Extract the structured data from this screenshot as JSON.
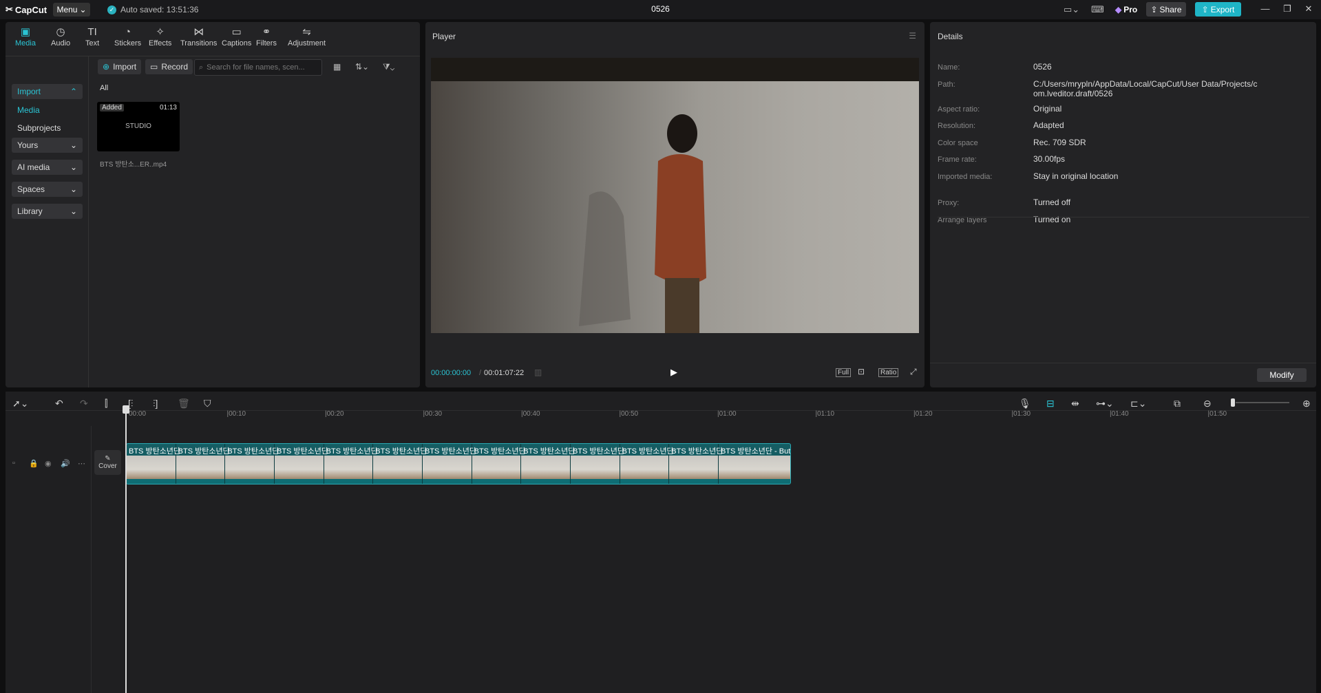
{
  "titlebar": {
    "logo": "CapCut",
    "menu": "Menu",
    "autosave": "Auto saved: 13:51:36",
    "project_title": "0526",
    "pro": "Pro",
    "share": "Share",
    "export": "Export"
  },
  "tabs": [
    {
      "label": "Media",
      "icon": "▣"
    },
    {
      "label": "Audio",
      "icon": "◷"
    },
    {
      "label": "Text",
      "icon": "TI"
    },
    {
      "label": "Stickers",
      "icon": "◔"
    },
    {
      "label": "Effects",
      "icon": "✧"
    },
    {
      "label": "Transitions",
      "icon": "⋈"
    },
    {
      "label": "Captions",
      "icon": "▭"
    },
    {
      "label": "Filters",
      "icon": "⚭"
    },
    {
      "label": "Adjustment",
      "icon": "⇋"
    }
  ],
  "sidebar": {
    "import": "Import",
    "media": "Media",
    "subprojects": "Subprojects",
    "yours": "Yours",
    "ai_media": "AI media",
    "spaces": "Spaces",
    "library": "Library"
  },
  "media": {
    "import_btn": "Import",
    "record_btn": "Record",
    "search_placeholder": "Search for file names, scen...",
    "filter_all": "All",
    "item": {
      "badge": "Added",
      "duration": "01:13",
      "thumb_text": "STUDIO",
      "filename": "BTS 방탄소...ER..mp4"
    }
  },
  "player": {
    "title": "Player",
    "current_time": "00:00:00:00",
    "total_time": "00:01:07:22",
    "full": "Full",
    "ratio": "Ratio"
  },
  "details": {
    "title": "Details",
    "rows": [
      {
        "label": "Name:",
        "value": "0526"
      },
      {
        "label": "Path:",
        "value": "C:/Users/mrypln/AppData/Local/CapCut/User Data/Projects/com.lveditor.draft/0526"
      },
      {
        "label": "Aspect ratio:",
        "value": "Original"
      },
      {
        "label": "Resolution:",
        "value": "Adapted"
      },
      {
        "label": "Color space",
        "value": "Rec. 709 SDR"
      },
      {
        "label": "Frame rate:",
        "value": "30.00fps"
      },
      {
        "label": "Imported media:",
        "value": "Stay in original location"
      },
      {
        "label": "Proxy:",
        "value": "Turned off"
      },
      {
        "label": "Arrange layers",
        "value": "Turned on"
      }
    ],
    "modify": "Modify"
  },
  "timeline": {
    "ticks": [
      "00:00",
      "|00:10",
      "|00:20",
      "|00:30",
      "|00:40",
      "|00:50",
      "|01:00",
      "|01:10",
      "|01:20",
      "|01:30",
      "|01:40",
      "|01:50"
    ],
    "cover": "Cover",
    "clips": [
      "BTS 방탄소년단",
      "BTS 방탄소년단",
      "BTS 방탄소년단",
      "BTS 방탄소년단",
      "BTS 방탄소년단",
      "BTS 방탄소년단",
      "BTS 방탄소년단",
      "BTS 방탄소년단",
      "BTS 방탄소년단",
      "BTS 방탄소년단",
      "BTS 방탄소년단",
      "BTS 방탄소년단",
      "BTS 방탄소년단 - Butt"
    ]
  }
}
